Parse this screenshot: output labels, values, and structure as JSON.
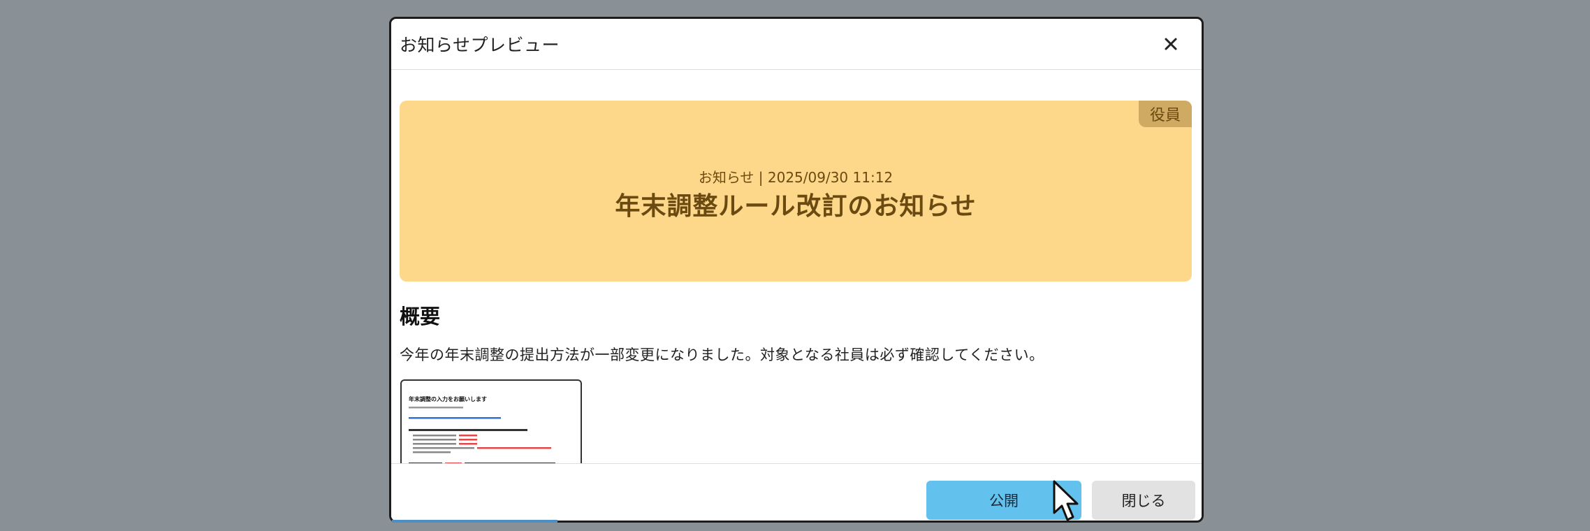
{
  "modal": {
    "title": "お知らせプレビュー",
    "close_icon": "close-icon"
  },
  "banner": {
    "role_badge": "役員",
    "meta": "お知らせ | 2025/09/30 11:12",
    "title": "年末調整ルール改訂のお知らせ",
    "background_color": "#fdd88a",
    "badge_color": "#cfaa62",
    "text_color": "#6b4a12"
  },
  "content": {
    "section_heading": "概要",
    "summary": "今年の年末調整の提出方法が一部変更になりました。対象となる社員は必ず確認してください。"
  },
  "attachment": {
    "title": "年末調整の入力をお願いします"
  },
  "footer": {
    "publish_label": "公開",
    "close_label": "閉じる",
    "publish_color": "#63c1ee"
  },
  "cursor_icon": "mouse-pointer-icon"
}
